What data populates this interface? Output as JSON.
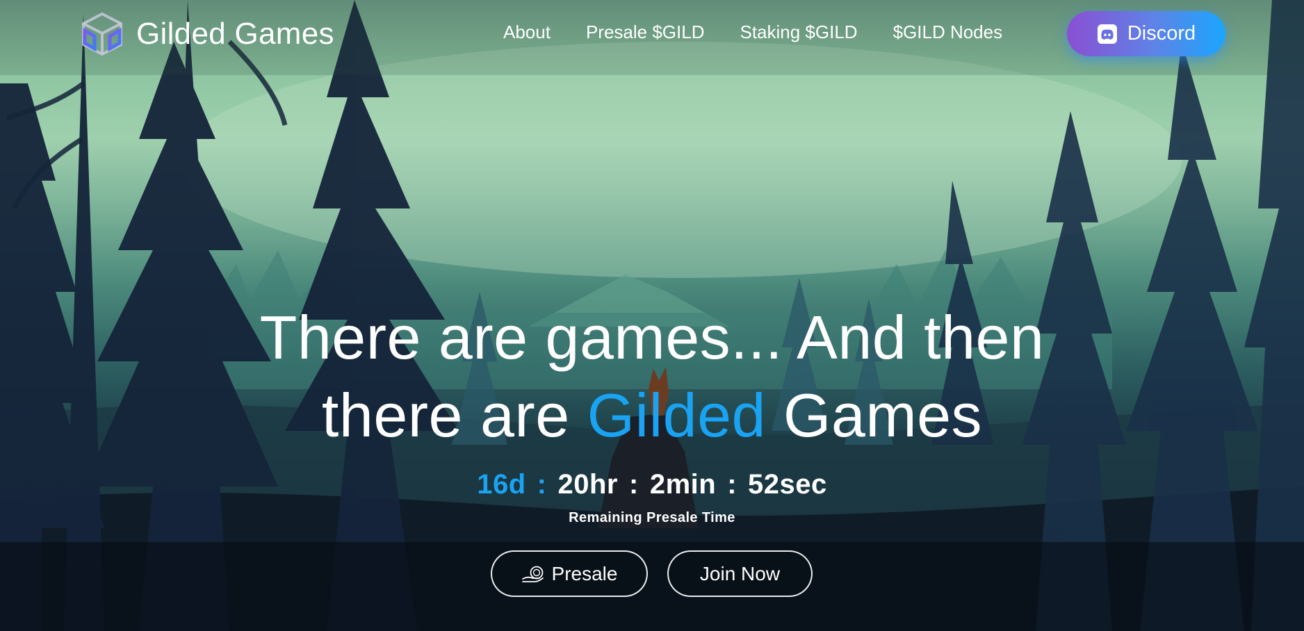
{
  "brand": {
    "name": "Gilded Games",
    "logo_icon": "cube-logo-icon"
  },
  "nav": {
    "items": [
      {
        "label": "About"
      },
      {
        "label": "Presale $GILD"
      },
      {
        "label": "Staking $GILD"
      },
      {
        "label": "$GILD Nodes"
      }
    ],
    "discord_button": {
      "label": "Discord",
      "icon": "discord-icon"
    }
  },
  "hero": {
    "title_line1": "There are games... And then",
    "title_line2_pre": "there are",
    "title_line2_accent": "Gilded",
    "title_line2_post": "Games"
  },
  "countdown": {
    "days": "16d",
    "hours": "20hr",
    "minutes": "2min",
    "seconds": "52sec",
    "separator": ":",
    "caption": "Remaining Presale Time"
  },
  "actions": {
    "presale": {
      "label": "Presale",
      "icon": "coin-stack-icon"
    },
    "join": {
      "label": "Join Now"
    }
  },
  "colors": {
    "accent": "#1aa3f3",
    "discord_gradient_start": "#8a4fd3",
    "discord_gradient_end": "#1aa6ff",
    "text": "#ffffff"
  }
}
